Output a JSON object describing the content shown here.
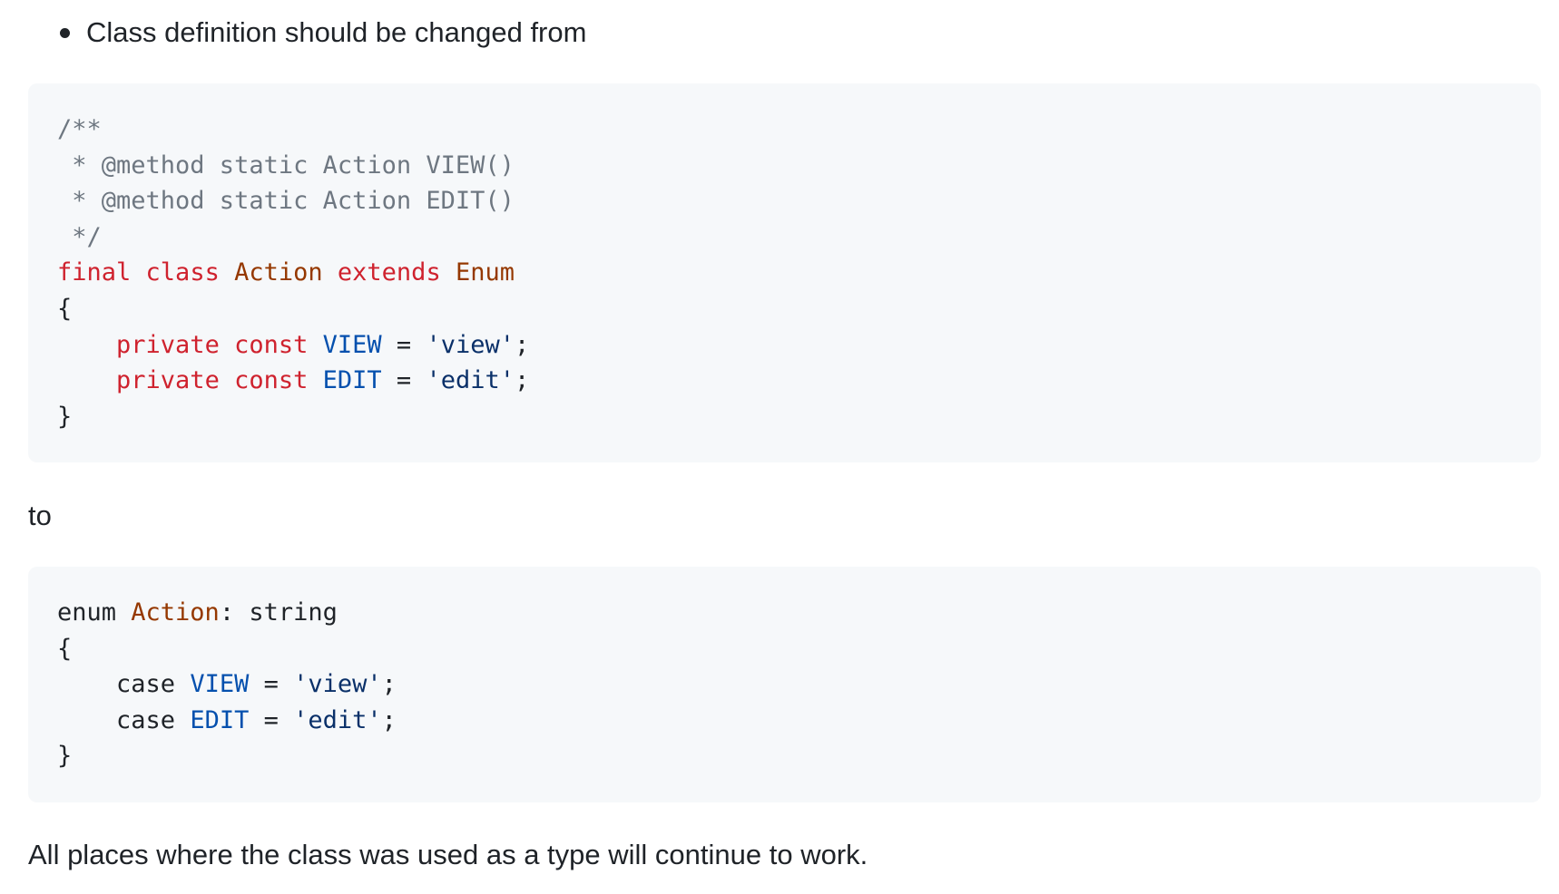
{
  "bullet_text": "Class definition should be changed from",
  "code_before": {
    "lines": [
      [
        {
          "t": "/**",
          "c": "c"
        }
      ],
      [
        {
          "t": " * @method static Action VIEW()",
          "c": "c"
        }
      ],
      [
        {
          "t": " * @method static Action EDIT()",
          "c": "c"
        }
      ],
      [
        {
          "t": " */",
          "c": "c"
        }
      ],
      [
        {
          "t": "final",
          "c": "k"
        },
        {
          "t": " "
        },
        {
          "t": "class",
          "c": "k"
        },
        {
          "t": " "
        },
        {
          "t": "Action",
          "c": "e"
        },
        {
          "t": " "
        },
        {
          "t": "extends",
          "c": "k"
        },
        {
          "t": " "
        },
        {
          "t": "Enum",
          "c": "e"
        }
      ],
      [
        {
          "t": "{"
        }
      ],
      [
        {
          "t": "    "
        },
        {
          "t": "private",
          "c": "k"
        },
        {
          "t": " "
        },
        {
          "t": "const",
          "c": "k"
        },
        {
          "t": " "
        },
        {
          "t": "VIEW",
          "c": "n"
        },
        {
          "t": " = "
        },
        {
          "t": "'view'",
          "c": "s"
        },
        {
          "t": ";"
        }
      ],
      [
        {
          "t": "    "
        },
        {
          "t": "private",
          "c": "k"
        },
        {
          "t": " "
        },
        {
          "t": "const",
          "c": "k"
        },
        {
          "t": " "
        },
        {
          "t": "EDIT",
          "c": "n"
        },
        {
          "t": " = "
        },
        {
          "t": "'edit'",
          "c": "s"
        },
        {
          "t": ";"
        }
      ],
      [
        {
          "t": "}"
        }
      ]
    ]
  },
  "middle_text": "to",
  "code_after": {
    "lines": [
      [
        {
          "t": "enum "
        },
        {
          "t": "Action",
          "c": "e"
        },
        {
          "t": ": string"
        }
      ],
      [
        {
          "t": "{"
        }
      ],
      [
        {
          "t": "    case "
        },
        {
          "t": "VIEW",
          "c": "n"
        },
        {
          "t": " = "
        },
        {
          "t": "'view'",
          "c": "s"
        },
        {
          "t": ";"
        }
      ],
      [
        {
          "t": "    case "
        },
        {
          "t": "EDIT",
          "c": "n"
        },
        {
          "t": " = "
        },
        {
          "t": "'edit'",
          "c": "s"
        },
        {
          "t": ";"
        }
      ],
      [
        {
          "t": "}"
        }
      ]
    ]
  },
  "footer_text": "All places where the class was used as a type will continue to work.",
  "colors": {
    "comment": "#6e7781",
    "keyword": "#cf222e",
    "entity": "#953800",
    "constant": "#0550ae",
    "string": "#0a3069",
    "code_bg": "#f6f8fa",
    "text": "#1f2328"
  }
}
